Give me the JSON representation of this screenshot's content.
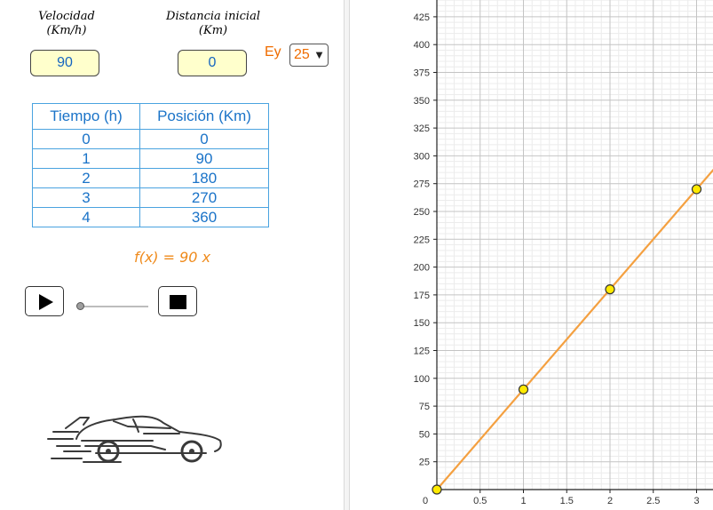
{
  "inputs": {
    "speed": {
      "label_line1": "Velocidad",
      "label_line2": "(Km/h)",
      "value": "90"
    },
    "initial_distance": {
      "label_line1": "Distancia inicial",
      "label_line2": "(Km)",
      "value": "0"
    }
  },
  "scale": {
    "label": "Ey",
    "selected": "25"
  },
  "table": {
    "headers": [
      "Tiempo (h)",
      "Posición (Km)"
    ],
    "rows": [
      [
        "0",
        "0"
      ],
      [
        "1",
        "90"
      ],
      [
        "2",
        "180"
      ],
      [
        "3",
        "270"
      ],
      [
        "4",
        "360"
      ]
    ]
  },
  "formula": "f(x) = 90 x",
  "controls": {
    "play_icon": "play-icon",
    "stop_icon": "stop-icon"
  },
  "chart_data": {
    "type": "line",
    "x_ticks": [
      "0",
      "0.5",
      "1",
      "1.5",
      "2",
      "2.5",
      "3"
    ],
    "y_ticks": [
      "25",
      "50",
      "75",
      "100",
      "125",
      "150",
      "175",
      "200",
      "225",
      "250",
      "275",
      "300",
      "325",
      "350",
      "375",
      "400",
      "425"
    ],
    "xlim": [
      0,
      3.2
    ],
    "ylim": [
      0,
      440
    ],
    "series": [
      {
        "x": [
          0,
          3.2
        ],
        "y": [
          0,
          288
        ],
        "color": "#f4a040"
      }
    ],
    "points": [
      {
        "x": 0,
        "y": 0
      },
      {
        "x": 1,
        "y": 90
      },
      {
        "x": 2,
        "y": 180
      },
      {
        "x": 3,
        "y": 270
      }
    ],
    "point_color": "#ffea00",
    "grid": true
  }
}
